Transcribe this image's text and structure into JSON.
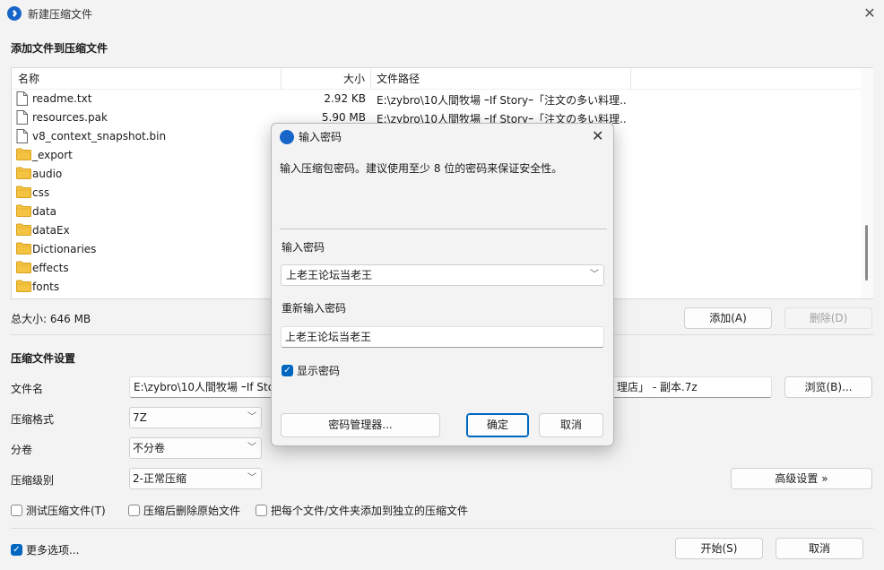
{
  "window": {
    "title": "新建压缩文件",
    "close": "✕"
  },
  "add_section": {
    "title": "添加文件到压缩文件"
  },
  "filelist": {
    "columns": {
      "name": "名称",
      "size": "大小",
      "path": "文件路径"
    },
    "rows": [
      {
        "name": "readme.txt",
        "size": "2.92 KB",
        "path": "E:\\zybro\\10人間牧場 ｰIf Storyｰ「注文の多い料理...",
        "type": "file"
      },
      {
        "name": "resources.pak",
        "size": "5.90 MB",
        "path": "E:\\zybro\\10人間牧場 ｰIf Storyｰ「注文の多い料理...",
        "type": "file"
      },
      {
        "name": "v8_context_snapshot.bin",
        "size": "",
        "path": "",
        "type": "file"
      },
      {
        "name": "_export",
        "size": "",
        "path": "",
        "type": "folder"
      },
      {
        "name": "audio",
        "size": "",
        "path": "",
        "type": "folder"
      },
      {
        "name": "css",
        "size": "",
        "path": "",
        "type": "folder"
      },
      {
        "name": "data",
        "size": "",
        "path": "",
        "type": "folder"
      },
      {
        "name": "dataEx",
        "size": "",
        "path": "",
        "type": "folder"
      },
      {
        "name": "Dictionaries",
        "size": "",
        "path": "",
        "type": "folder"
      },
      {
        "name": "effects",
        "size": "",
        "path": "",
        "type": "folder"
      },
      {
        "name": "fonts",
        "size": "",
        "path": "",
        "type": "folder"
      }
    ]
  },
  "total": {
    "label": "总大小: 646 MB"
  },
  "buttons": {
    "add": "添加(A)",
    "delete": "删除(D)",
    "browse": "浏览(B)...",
    "advanced": "高级设置 »",
    "start": "开始(S)",
    "cancel": "取消"
  },
  "settings": {
    "title": "压缩文件设置",
    "filename_label": "文件名",
    "filename_left": "E:\\zybro\\10人間牧場 ｰIf Sto",
    "filename_right": "理店」 - 副本.7z",
    "format_label": "压缩格式",
    "format_value": "7Z",
    "volume_label": "分卷",
    "volume_value": "不分卷",
    "level_label": "压缩级别",
    "level_value": "2-正常压缩"
  },
  "checks": {
    "test": "测试压缩文件(T)",
    "delete_after": "压缩后删除原始文件",
    "each_separate": "把每个文件/文件夹添加到独立的压缩文件",
    "more": "更多选项..."
  },
  "dialog": {
    "title": "输入密码",
    "close": "✕",
    "description": "输入压缩包密码。建议使用至少 8 位的密码来保证安全性。",
    "password_label": "输入密码",
    "password_value": "上老王论坛当老王",
    "repeat_label": "重新输入密码",
    "repeat_value": "上老王论坛当老王",
    "show_password": "显示密码",
    "manager": "密码管理器...",
    "ok": "确定",
    "cancel": "取消"
  }
}
